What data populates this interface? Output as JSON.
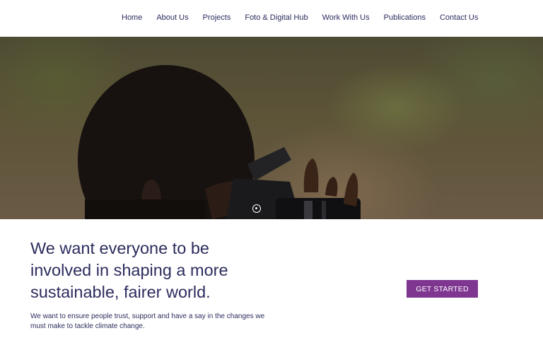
{
  "nav": {
    "items": [
      {
        "label": "Home"
      },
      {
        "label": "About Us"
      },
      {
        "label": "Projects"
      },
      {
        "label": "Foto & Digital Hub"
      },
      {
        "label": "Work With Us"
      },
      {
        "label": "Publications"
      },
      {
        "label": "Contact Us"
      }
    ]
  },
  "hero": {
    "image_subject": "person-with-camera-photo",
    "slides_total": 1,
    "active_slide": 1
  },
  "main": {
    "headline": "We want everyone to be involved in shaping a more sustainable, fairer world.",
    "subtext": "We want to ensure people trust, support and have a say in the changes we must make to tackle climate change.",
    "cta_label": "GET STARTED"
  },
  "colors": {
    "text": "#2c2c5e",
    "cta_background": "#7f3691",
    "cta_text": "#ffffff"
  }
}
